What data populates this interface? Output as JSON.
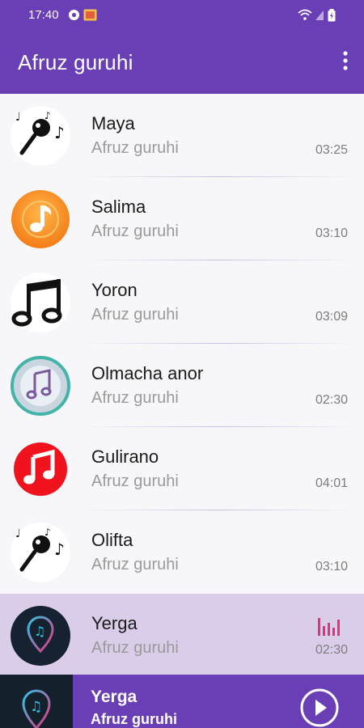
{
  "status_bar": {
    "time": "17:40",
    "icons": [
      "camera-icon",
      "gallery-icon",
      "wifi-icon",
      "signal-icon",
      "battery-icon"
    ]
  },
  "app_bar": {
    "title": "Afruz guruhi",
    "menu_icon": "more-vertical-icon"
  },
  "songs": [
    {
      "title": "Maya",
      "artist": "Afruz guruhi",
      "duration": "03:25",
      "icon": "microphone-notes-icon"
    },
    {
      "title": "Salima",
      "artist": "Afruz guruhi",
      "duration": "03:10",
      "icon": "orange-music-note-icon"
    },
    {
      "title": "Yoron",
      "artist": "Afruz guruhi",
      "duration": "03:09",
      "icon": "black-music-notes-icon"
    },
    {
      "title": "Olmacha anor",
      "artist": "Afruz guruhi",
      "duration": "02:30",
      "icon": "itunes-note-icon"
    },
    {
      "title": "Gulirano",
      "artist": "Afruz guruhi",
      "duration": "04:01",
      "icon": "red-music-note-icon"
    },
    {
      "title": "Olifta",
      "artist": "Afruz guruhi",
      "duration": "03:10",
      "icon": "microphone-notes-icon"
    },
    {
      "title": "Yerga",
      "artist": "Afruz guruhi",
      "duration": "02:30",
      "icon": "music-pin-icon",
      "playing": true
    }
  ],
  "now_playing": {
    "title": "Yerga",
    "artist": "Afruz guruhi",
    "play_icon": "play-icon"
  },
  "colors": {
    "primary": "#6a3fb6",
    "active_row": "#d9cdea",
    "equalizer": "#e8307a"
  }
}
